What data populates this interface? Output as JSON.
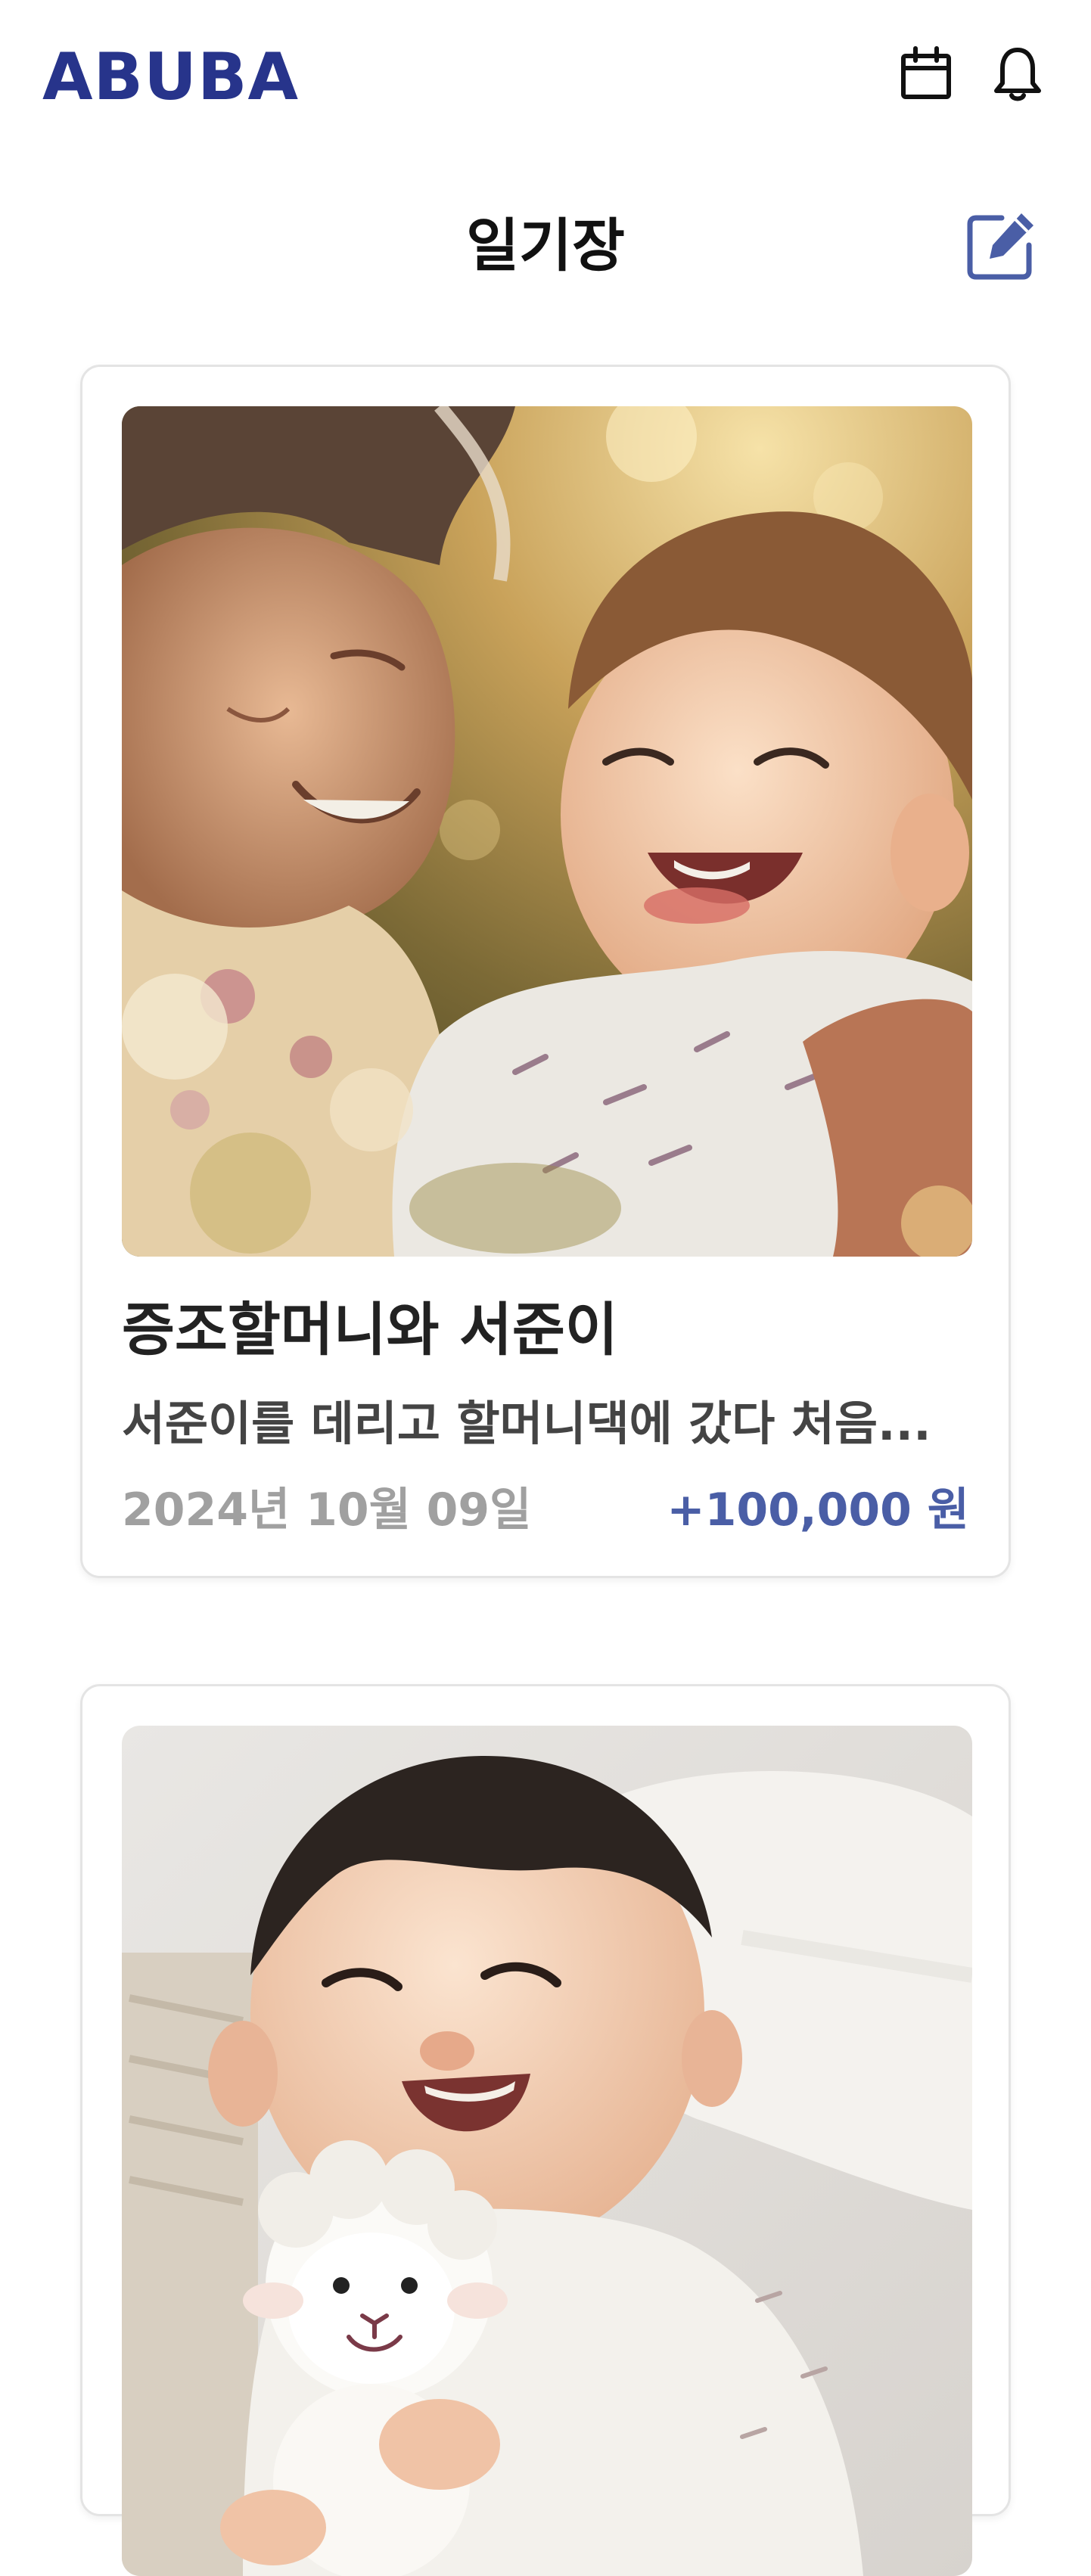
{
  "header": {
    "logo_text": "ABUBA",
    "logo_color": "#27348b",
    "icons": [
      "calendar-icon",
      "bell-icon"
    ]
  },
  "page": {
    "title": "일기장",
    "edit_icon": "edit-icon",
    "accent_color": "#4a5ea6"
  },
  "diary_entries": [
    {
      "photo": "grandmother-holding-laughing-baby",
      "title": "증조할머니와 서준이",
      "excerpt": "서준이를 데리고 할머니댁에 갔다 처음...",
      "date": "2024년 10월 09일",
      "amount": "+100,000 원"
    },
    {
      "photo": "laughing-baby-with-plush-lamb"
    }
  ]
}
